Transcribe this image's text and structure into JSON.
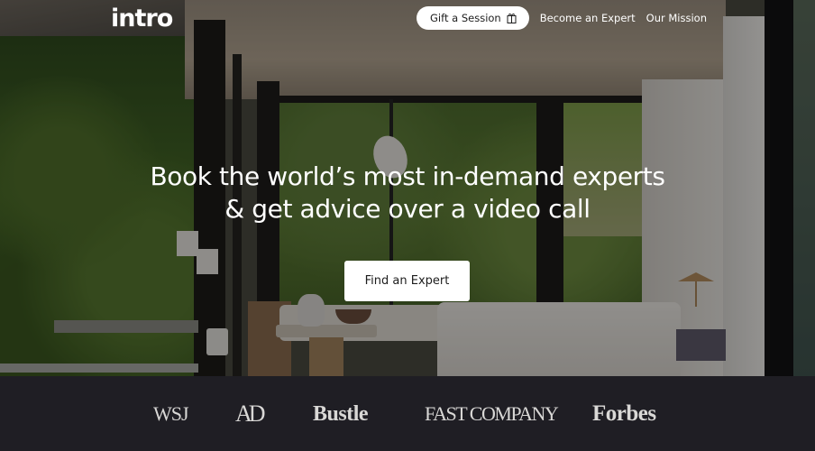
{
  "header": {
    "logo": "intro",
    "nav": {
      "gift_label": "Gift a Session",
      "gift_icon": "gift-icon",
      "become_expert": "Become an Expert",
      "our_mission": "Our Mission"
    }
  },
  "hero": {
    "headline_line1": "Book the world’s most in-demand experts",
    "headline_line2": "& get advice over a video call",
    "cta_label": "Find an Expert"
  },
  "press": {
    "logos": [
      "WSJ",
      "AD",
      "Bustle",
      "FAST COMPANY",
      "Forbes"
    ]
  },
  "colors": {
    "press_bar_bg": "#1f1e24",
    "press_logo": "#d9d8d6",
    "button_bg": "#ffffff",
    "button_text": "#1d1d1d"
  }
}
